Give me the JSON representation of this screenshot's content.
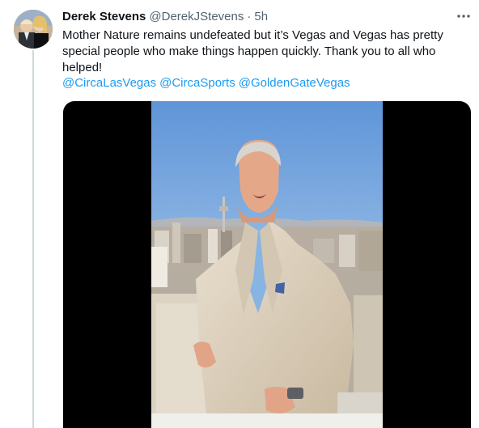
{
  "tweet": {
    "author_name": "Derek Stevens",
    "author_handle": "@DerekJStevens",
    "separator": "·",
    "timestamp": "5h",
    "text": "Mother Nature remains undefeated but it’s Vegas and Vegas has pretty special people who make things happen quickly. Thank you to all who helped!",
    "mentions": [
      "@CircaLasVegas",
      "@CircaSports",
      "@GoldenGateVegas"
    ]
  },
  "colors": {
    "link": "#1d9bf0",
    "secondary_text": "#536471",
    "primary_text": "#0f1419",
    "rail": "#cfd9de"
  },
  "icons": {
    "more": "more-horizontal-icon"
  }
}
